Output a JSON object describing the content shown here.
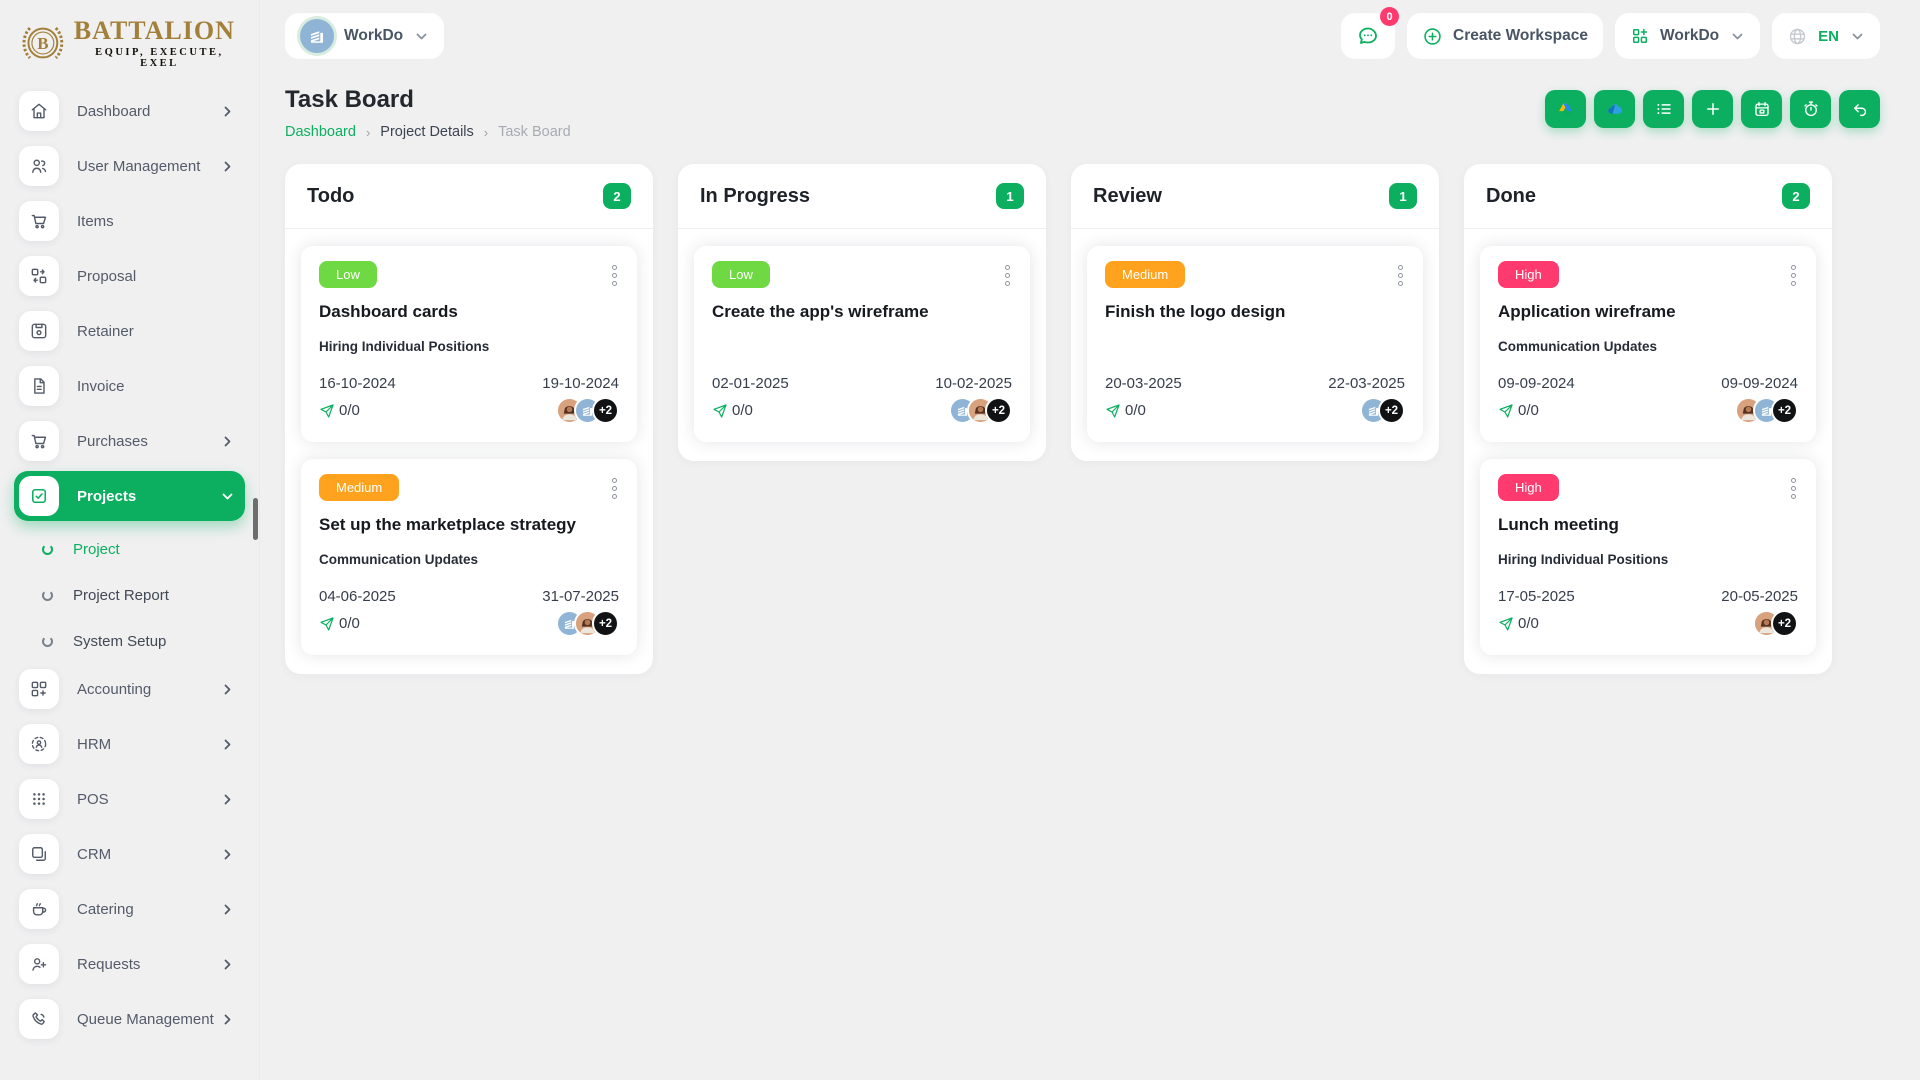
{
  "brand": {
    "name": "BATTALION",
    "tagline": "EQUIP, EXECUTE, EXEL"
  },
  "topbar": {
    "workspace_pill": {
      "label": "WorkDo"
    },
    "chat": {
      "badge": "0"
    },
    "create_workspace": {
      "label": "Create Workspace"
    },
    "workspace_switcher": {
      "label": "WorkDo"
    },
    "language": {
      "label": "EN"
    }
  },
  "sidebar": {
    "items": [
      {
        "label": "Dashboard",
        "expandable": true
      },
      {
        "label": "User Management",
        "expandable": true
      },
      {
        "label": "Items",
        "expandable": false
      },
      {
        "label": "Proposal",
        "expandable": false
      },
      {
        "label": "Retainer",
        "expandable": false
      },
      {
        "label": "Invoice",
        "expandable": false
      },
      {
        "label": "Purchases",
        "expandable": true
      },
      {
        "label": "Projects",
        "expandable": true,
        "active": true
      },
      {
        "label": "Accounting",
        "expandable": true
      },
      {
        "label": "HRM",
        "expandable": true
      },
      {
        "label": "POS",
        "expandable": true
      },
      {
        "label": "CRM",
        "expandable": true
      },
      {
        "label": "Catering",
        "expandable": true
      },
      {
        "label": "Requests",
        "expandable": true
      },
      {
        "label": "Queue Management",
        "expandable": true
      }
    ],
    "projects_children": [
      {
        "label": "Project",
        "active": true
      },
      {
        "label": "Project Report",
        "active": false
      },
      {
        "label": "System Setup",
        "active": false
      }
    ]
  },
  "page": {
    "title": "Task Board",
    "breadcrumb": {
      "home": "Dashboard",
      "middle": "Project Details",
      "current": "Task Board"
    }
  },
  "toolbar": {
    "buttons": [
      {
        "name": "google-drive"
      },
      {
        "name": "onedrive"
      },
      {
        "name": "list"
      },
      {
        "name": "add"
      },
      {
        "name": "calendar"
      },
      {
        "name": "timer"
      },
      {
        "name": "undo"
      }
    ]
  },
  "colors": {
    "primary_green": "#0caf60",
    "priority_low": "#6fd943",
    "priority_medium": "#ffa21d",
    "priority_high": "#ff3a6e",
    "badge_red": "#ff3a6e",
    "brand_gold": "#a3803a"
  },
  "board": {
    "columns": [
      {
        "title": "Todo",
        "count": "2",
        "cards": [
          {
            "priority": "Low",
            "priority_color": "#6fd943",
            "title": "Dashboard cards",
            "milestone": "Hiring Individual Positions",
            "start_date": "16-10-2024",
            "end_date": "19-10-2024",
            "checklist": "0/0",
            "avatars": [
              {
                "type": "woman-photo"
              },
              {
                "type": "company-logo"
              },
              {
                "type": "more",
                "label": "+2"
              }
            ]
          },
          {
            "priority": "Medium",
            "priority_color": "#ffa21d",
            "title": "Set up the marketplace strategy",
            "milestone": "Communication Updates",
            "start_date": "04-06-2025",
            "end_date": "31-07-2025",
            "checklist": "0/0",
            "avatars": [
              {
                "type": "company-logo"
              },
              {
                "type": "woman-photo"
              },
              {
                "type": "more",
                "label": "+2"
              }
            ]
          }
        ]
      },
      {
        "title": "In Progress",
        "count": "1",
        "cards": [
          {
            "priority": "Low",
            "priority_color": "#6fd943",
            "title": "Create the app's wireframe",
            "milestone": "",
            "start_date": "02-01-2025",
            "end_date": "10-02-2025",
            "checklist": "0/0",
            "avatars": [
              {
                "type": "company-logo"
              },
              {
                "type": "woman-photo"
              },
              {
                "type": "more",
                "label": "+2"
              }
            ]
          }
        ]
      },
      {
        "title": "Review",
        "count": "1",
        "cards": [
          {
            "priority": "Medium",
            "priority_color": "#ffa21d",
            "title": "Finish the logo design",
            "milestone": "",
            "start_date": "20-03-2025",
            "end_date": "22-03-2025",
            "checklist": "0/0",
            "avatars": [
              {
                "type": "company-logo"
              },
              {
                "type": "more",
                "label": "+2"
              }
            ]
          }
        ]
      },
      {
        "title": "Done",
        "count": "2",
        "cards": [
          {
            "priority": "High",
            "priority_color": "#ff3a6e",
            "title": "Application wireframe",
            "milestone": "Communication Updates",
            "start_date": "09-09-2024",
            "end_date": "09-09-2024",
            "checklist": "0/0",
            "avatars": [
              {
                "type": "woman-photo"
              },
              {
                "type": "company-logo"
              },
              {
                "type": "more",
                "label": "+2"
              }
            ]
          },
          {
            "priority": "High",
            "priority_color": "#ff3a6e",
            "title": "Lunch meeting",
            "milestone": "Hiring Individual Positions",
            "start_date": "17-05-2025",
            "end_date": "20-05-2025",
            "checklist": "0/0",
            "avatars": [
              {
                "type": "woman-photo"
              },
              {
                "type": "more",
                "label": "+2"
              }
            ]
          }
        ]
      }
    ]
  }
}
